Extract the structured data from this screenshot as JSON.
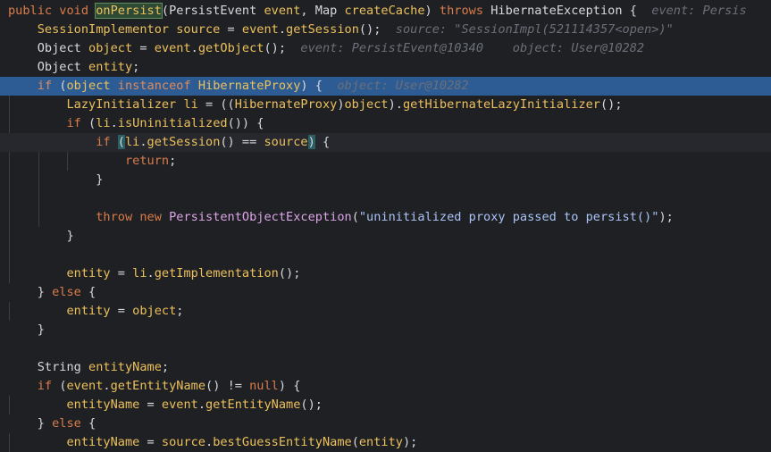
{
  "colors": {
    "background": "#1f2024",
    "selection": "#2d5c94",
    "keyword": "#d97c4a",
    "method": "#ecc15c",
    "string": "#a9c4f7",
    "hint": "#6b6f78",
    "field": "#dba4e6"
  },
  "lines": [
    {
      "indent": 0,
      "tokens": [
        {
          "t": "public ",
          "c": "kw"
        },
        {
          "t": "void ",
          "c": "kw"
        },
        {
          "t": "onPersist",
          "c": "fn",
          "box": true
        },
        {
          "t": "(PersistEvent ",
          "c": "ty"
        },
        {
          "t": "event",
          "c": "var"
        },
        {
          "t": ", Map ",
          "c": "ty"
        },
        {
          "t": "createCache",
          "c": "var"
        },
        {
          "t": ") ",
          "c": "plain"
        },
        {
          "t": "throws ",
          "c": "kw"
        },
        {
          "t": "HibernateException {",
          "c": "ty"
        },
        {
          "t": "  event: Persis",
          "c": "hint"
        }
      ]
    },
    {
      "indent": 1,
      "tokens": [
        {
          "t": "SessionImplementor ",
          "c": "var"
        },
        {
          "t": "source",
          "c": "var"
        },
        {
          "t": " = ",
          "c": "plain"
        },
        {
          "t": "event",
          "c": "var"
        },
        {
          "t": ".",
          "c": "plain"
        },
        {
          "t": "getSession",
          "c": "fn"
        },
        {
          "t": "();",
          "c": "plain"
        },
        {
          "t": "  source: \"SessionImpl(521114357<open>)\"",
          "c": "hint"
        }
      ]
    },
    {
      "indent": 1,
      "tokens": [
        {
          "t": "Object ",
          "c": "ty"
        },
        {
          "t": "object",
          "c": "var"
        },
        {
          "t": " = ",
          "c": "plain"
        },
        {
          "t": "event",
          "c": "var"
        },
        {
          "t": ".",
          "c": "plain"
        },
        {
          "t": "getObject",
          "c": "fn"
        },
        {
          "t": "();",
          "c": "plain"
        },
        {
          "t": "  event: PersistEvent@10340    object: User@10282",
          "c": "hint"
        }
      ]
    },
    {
      "indent": 1,
      "tokens": [
        {
          "t": "Object ",
          "c": "ty"
        },
        {
          "t": "entity",
          "c": "var"
        },
        {
          "t": ";",
          "c": "plain"
        }
      ]
    },
    {
      "indent": 1,
      "highlight": true,
      "tokens": [
        {
          "t": "if ",
          "c": "kw"
        },
        {
          "t": "(",
          "c": "plain"
        },
        {
          "t": "object ",
          "c": "var"
        },
        {
          "t": "instanceof ",
          "c": "kw"
        },
        {
          "t": "HibernateProxy",
          "c": "var"
        },
        {
          "t": ") {",
          "c": "plain"
        },
        {
          "t": "  object: User@10282",
          "c": "hint"
        }
      ]
    },
    {
      "indent": 2,
      "tokens": [
        {
          "t": "LazyInitializer ",
          "c": "var"
        },
        {
          "t": "li",
          "c": "var"
        },
        {
          "t": " = ((",
          "c": "plain"
        },
        {
          "t": "HibernateProxy",
          "c": "var"
        },
        {
          "t": ")",
          "c": "plain"
        },
        {
          "t": "object",
          "c": "var"
        },
        {
          "t": ").",
          "c": "plain"
        },
        {
          "t": "getHibernateLazyInitializer",
          "c": "fn"
        },
        {
          "t": "();",
          "c": "plain"
        }
      ]
    },
    {
      "indent": 2,
      "tokens": [
        {
          "t": "if ",
          "c": "kw"
        },
        {
          "t": "(",
          "c": "plain"
        },
        {
          "t": "li",
          "c": "var"
        },
        {
          "t": ".",
          "c": "plain"
        },
        {
          "t": "isUninitialized",
          "c": "fn"
        },
        {
          "t": "()) {",
          "c": "plain"
        }
      ]
    },
    {
      "indent": 3,
      "current": true,
      "tokens": [
        {
          "t": "if ",
          "c": "kw"
        },
        {
          "t": "(",
          "c": "plain",
          "brace": true
        },
        {
          "t": "li",
          "c": "var"
        },
        {
          "t": ".",
          "c": "plain"
        },
        {
          "t": "getSession",
          "c": "fn"
        },
        {
          "t": "() == ",
          "c": "plain"
        },
        {
          "t": "source",
          "c": "var"
        },
        {
          "t": ")",
          "c": "plain",
          "brace": true
        },
        {
          "t": " {",
          "c": "plain"
        }
      ]
    },
    {
      "indent": 4,
      "tokens": [
        {
          "t": "return",
          "c": "kw"
        },
        {
          "t": ";",
          "c": "plain"
        }
      ]
    },
    {
      "indent": 3,
      "tokens": [
        {
          "t": "}",
          "c": "plain"
        }
      ]
    },
    {
      "indent": 0,
      "tokens": []
    },
    {
      "indent": 3,
      "tokens": [
        {
          "t": "throw ",
          "c": "kw"
        },
        {
          "t": "new ",
          "c": "kw"
        },
        {
          "t": "PersistentObjectException",
          "c": "fld"
        },
        {
          "t": "(",
          "c": "plain"
        },
        {
          "t": "\"uninitialized proxy passed to persist()\"",
          "c": "str"
        },
        {
          "t": ");",
          "c": "plain"
        }
      ]
    },
    {
      "indent": 2,
      "tokens": [
        {
          "t": "}",
          "c": "plain"
        }
      ]
    },
    {
      "indent": 0,
      "tokens": []
    },
    {
      "indent": 2,
      "tokens": [
        {
          "t": "entity",
          "c": "var"
        },
        {
          "t": " = ",
          "c": "plain"
        },
        {
          "t": "li",
          "c": "var"
        },
        {
          "t": ".",
          "c": "plain"
        },
        {
          "t": "getImplementation",
          "c": "fn"
        },
        {
          "t": "();",
          "c": "plain"
        }
      ]
    },
    {
      "indent": 1,
      "tokens": [
        {
          "t": "} ",
          "c": "plain"
        },
        {
          "t": "else",
          "c": "kw"
        },
        {
          "t": " {",
          "c": "plain"
        }
      ]
    },
    {
      "indent": 2,
      "tokens": [
        {
          "t": "entity",
          "c": "var"
        },
        {
          "t": " = ",
          "c": "plain"
        },
        {
          "t": "object",
          "c": "var"
        },
        {
          "t": ";",
          "c": "plain"
        }
      ]
    },
    {
      "indent": 1,
      "tokens": [
        {
          "t": "}",
          "c": "plain"
        }
      ]
    },
    {
      "indent": 0,
      "tokens": []
    },
    {
      "indent": 1,
      "tokens": [
        {
          "t": "String ",
          "c": "ty"
        },
        {
          "t": "entityName",
          "c": "var"
        },
        {
          "t": ";",
          "c": "plain"
        }
      ]
    },
    {
      "indent": 1,
      "tokens": [
        {
          "t": "if ",
          "c": "kw"
        },
        {
          "t": "(",
          "c": "plain"
        },
        {
          "t": "event",
          "c": "var"
        },
        {
          "t": ".",
          "c": "plain"
        },
        {
          "t": "getEntityName",
          "c": "fn"
        },
        {
          "t": "() != ",
          "c": "plain"
        },
        {
          "t": "null",
          "c": "kw"
        },
        {
          "t": ") {",
          "c": "plain"
        }
      ]
    },
    {
      "indent": 2,
      "tokens": [
        {
          "t": "entityName",
          "c": "var"
        },
        {
          "t": " = ",
          "c": "plain"
        },
        {
          "t": "event",
          "c": "var"
        },
        {
          "t": ".",
          "c": "plain"
        },
        {
          "t": "getEntityName",
          "c": "fn"
        },
        {
          "t": "();",
          "c": "plain"
        }
      ]
    },
    {
      "indent": 1,
      "tokens": [
        {
          "t": "} ",
          "c": "plain"
        },
        {
          "t": "else",
          "c": "kw"
        },
        {
          "t": " {",
          "c": "plain"
        }
      ]
    },
    {
      "indent": 2,
      "tokens": [
        {
          "t": "entityName",
          "c": "var"
        },
        {
          "t": " = ",
          "c": "plain"
        },
        {
          "t": "source",
          "c": "var"
        },
        {
          "t": ".",
          "c": "plain"
        },
        {
          "t": "bestGuessEntityName",
          "c": "fn"
        },
        {
          "t": "(",
          "c": "plain"
        },
        {
          "t": "entity",
          "c": "var"
        },
        {
          "t": ");",
          "c": "plain"
        }
      ]
    }
  ]
}
